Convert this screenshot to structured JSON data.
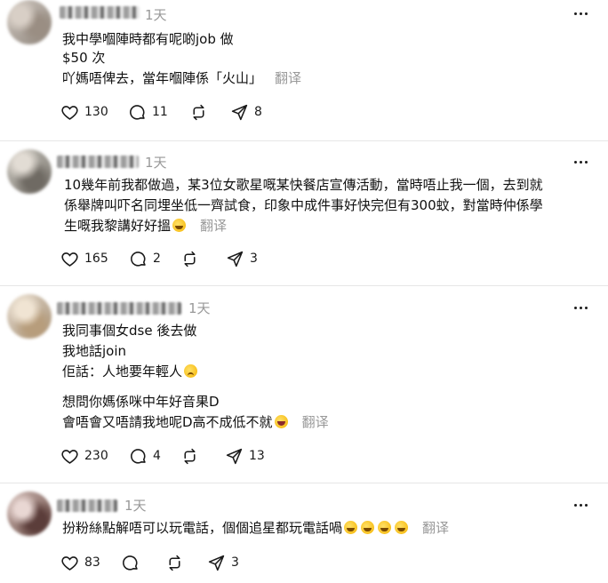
{
  "posts": [
    {
      "time": "1天",
      "lines": [
        "我中學嗰陣時都有呢啲job 做",
        "$50 次",
        "吖媽唔俾去，當年嗰陣係「火山」"
      ],
      "translate": "翻译",
      "likes": "130",
      "comments": "11",
      "reposts": "",
      "shares": "8"
    },
    {
      "time": "1天",
      "lines": [
        "10幾年前我都做過，某3位女歌星嘅某快餐店宣傳活動，當時唔止我一個，去到就",
        "係舉牌叫吓名同埋坐低一齊試食，印象中成件事好快完但有300蚊，對當時仲係學",
        "生嘅我黎講好好搵"
      ],
      "translate": "翻译",
      "likes": "165",
      "comments": "2",
      "reposts": "",
      "shares": "3"
    },
    {
      "time": "1天",
      "lines": [
        "我同事個女dse 後去做",
        "我地話join",
        "佢話：人地要年輕人",
        "想問你媽係咪中年好音果D",
        "會唔會又唔請我地呢D高不成低不就"
      ],
      "translate": "翻译",
      "likes": "230",
      "comments": "4",
      "reposts": "",
      "shares": "13"
    },
    {
      "time": "1天",
      "lines": [
        "扮粉絲點解唔可以玩電話，個個追星都玩電話喎"
      ],
      "translate": "翻译",
      "likes": "83",
      "comments": "",
      "reposts": "",
      "shares": "3"
    }
  ],
  "icons": {
    "like": "heart-icon",
    "comment": "comment-bubble-icon",
    "repost": "repost-arrows-icon",
    "share": "send-arrow-icon",
    "more": "more-dots-icon",
    "emoji_laugh": "rolling-laughing-emoji",
    "emoji_sad": "pleading-face-emoji",
    "emoji_grin": "laughing-face-emoji"
  },
  "colors": {
    "text": "#101010",
    "muted": "#999999",
    "divider": "#e6e6e6"
  }
}
